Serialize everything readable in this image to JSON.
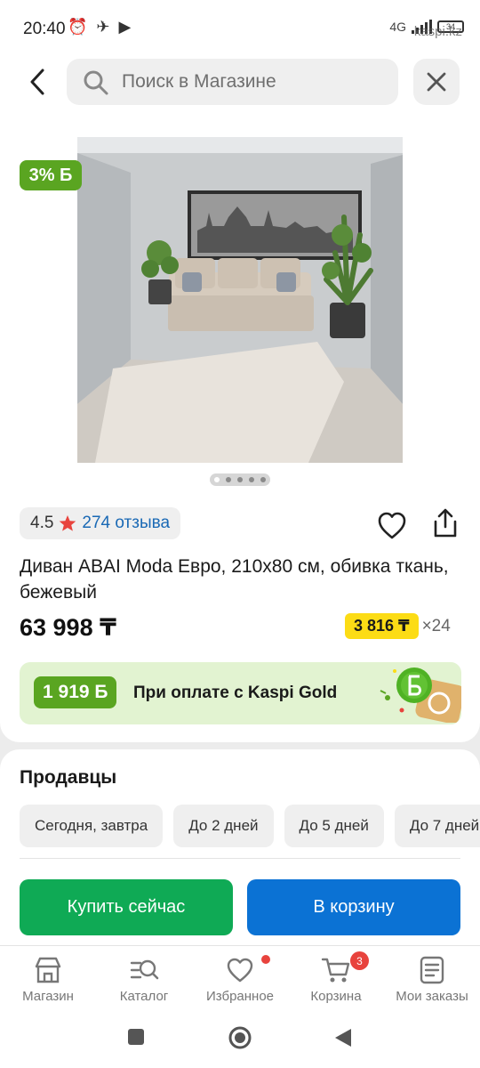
{
  "status_bar": {
    "time": "20:40",
    "network": "4G",
    "battery": "34",
    "watermark": "kaspi.kz"
  },
  "header": {
    "search_placeholder": "Поиск в Магазине"
  },
  "product": {
    "cashback_badge": "3% Б",
    "image_count": 5,
    "image_active_index": 0,
    "rating": "4.5",
    "reviews": "274 отзыва",
    "title": "Диван ABAI Moda Евро, 210x80 см, обивка ткань, бежевый",
    "price": "63 998 ₸",
    "installment_amount": "3 816 ₸",
    "installment_months": "×24"
  },
  "gold_banner": {
    "bonus": "1 919 Б",
    "text": "При оплате с Kaspi Gold"
  },
  "sellers": {
    "title": "Продавцы",
    "filters": [
      "Сегодня, завтра",
      "До 2 дней",
      "До 5 дней",
      "До 7 дней"
    ]
  },
  "actions": {
    "buy_now": "Купить сейчас",
    "add_to_cart": "В корзину"
  },
  "bottom_nav": {
    "items": [
      {
        "label": "Магазин",
        "icon": "shop-icon"
      },
      {
        "label": "Каталог",
        "icon": "catalog-search-icon"
      },
      {
        "label": "Избранное",
        "icon": "heart-icon"
      },
      {
        "label": "Корзина",
        "icon": "cart-icon"
      },
      {
        "label": "Мои заказы",
        "icon": "orders-icon"
      }
    ],
    "cart_badge": "3"
  },
  "colors": {
    "green": "#5aa521",
    "buy_green": "#0faa55",
    "cart_blue": "#0b72d4",
    "installment_yellow": "#fcdc15",
    "link_blue": "#1a69b5",
    "badge_red": "#e8433d"
  }
}
